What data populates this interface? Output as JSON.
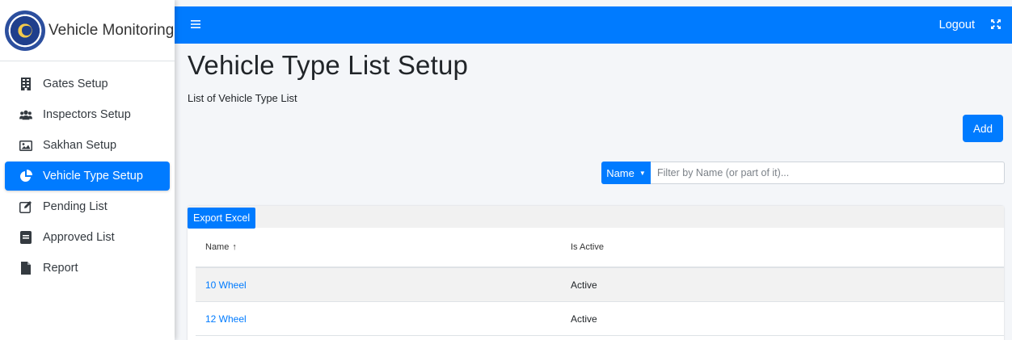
{
  "brand": {
    "title": "Vehicle Monitoring"
  },
  "sidebar": {
    "items": [
      {
        "label": "Gates Setup",
        "icon": "building-icon"
      },
      {
        "label": "Inspectors Setup",
        "icon": "users-icon"
      },
      {
        "label": "Sakhan Setup",
        "icon": "image-icon"
      },
      {
        "label": "Vehicle Type Setup",
        "icon": "pie-chart-icon",
        "active": true
      },
      {
        "label": "Pending List",
        "icon": "edit-icon"
      },
      {
        "label": "Approved List",
        "icon": "list-icon"
      },
      {
        "label": "Report",
        "icon": "file-icon"
      }
    ]
  },
  "topbar": {
    "menu_icon": "hamburger-icon",
    "logout_label": "Logout",
    "expand_icon": "expand-icon",
    "color": "#007bff"
  },
  "page": {
    "title": "Vehicle Type List Setup",
    "subtitle": "List of Vehicle Type List",
    "add_label": "Add"
  },
  "filter": {
    "field_label": "Name",
    "placeholder": "Filter by Name (or part of it)..."
  },
  "table": {
    "export_label": "Export Excel",
    "columns": {
      "name": "Name",
      "is_active": "Is Active"
    },
    "sort_indicator": "↑",
    "rows": [
      {
        "name": "10 Wheel",
        "status": "Active"
      },
      {
        "name": "12 Wheel",
        "status": "Active"
      }
    ]
  },
  "colors": {
    "accent": "#007bff",
    "background": "#f4f6f9"
  }
}
